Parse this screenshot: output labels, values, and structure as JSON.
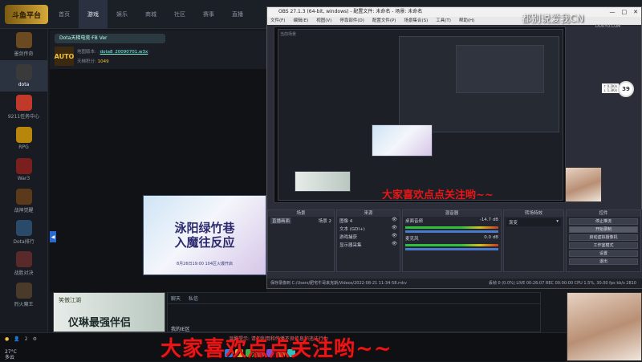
{
  "app": {
    "logo_text": "斗鱼平台",
    "nav": [
      "首页",
      "游戏",
      "娱乐",
      "商城",
      "社区",
      "赛事",
      "直播"
    ]
  },
  "sidebar": {
    "items": [
      {
        "label": "墨剑传奇",
        "color": "#6b4a22"
      },
      {
        "label": "dota",
        "color": "#3a3a3a"
      },
      {
        "label": "9211任务中心",
        "color": "#c0392b"
      },
      {
        "label": "RPG",
        "color": "#b8860b"
      },
      {
        "label": "War3",
        "color": "#7a1e1e"
      },
      {
        "label": "战神觉醒",
        "color": "#5a3a1a"
      },
      {
        "label": "Dota排行",
        "color": "#2a4a6a"
      },
      {
        "label": "战胜对决",
        "color": "#5a2a2a"
      },
      {
        "label": "烈火魔王",
        "color": "#4a3a2a"
      }
    ]
  },
  "room": {
    "title": "Dota天梯电竞·FB Ver",
    "avatar_text": "AUTO",
    "map_label": "地图版本:",
    "map_value": "dota8_20090701.w3x",
    "online_label": "天梯积分:",
    "online_value": "1049"
  },
  "banner": {
    "title_line1": "泳阳绿竹巷",
    "title_line2": "入魔往反应",
    "subtitle": "8月26日19:00 104区火爆开启"
  },
  "poster": {
    "top_text": "笑傲江湖",
    "main_text": "仪琳最强伴侣"
  },
  "chat": {
    "tabs": [
      "聊天",
      "私信"
    ],
    "line": "我的IE区"
  },
  "obs": {
    "title": "OBS 27.1.3 (64-bit, windows) - 配置文件: 未命名 - 场景: 未命名",
    "menu": [
      "文件(F)",
      "编辑(E)",
      "视图(V)",
      "停靠部件(D)",
      "配置文件(P)",
      "场景集合(S)",
      "工具(T)",
      "帮助(H)"
    ],
    "dock_scenes": "场景",
    "dock_sources": "来源",
    "dock_mixer": "混音器",
    "dock_transitions": "转场特效",
    "dock_controls": "控件",
    "scene_items": [
      "直播画面",
      "场景 2"
    ],
    "source_items": [
      "图像 4",
      "文本 (GDI+)",
      "游戏捕获",
      "显示器采集"
    ],
    "mixer_items": [
      {
        "name": "桌面音频",
        "db": "-14.7 dB"
      },
      {
        "name": "麦克风",
        "db": "0.0 dB"
      }
    ],
    "transition_value": "渐变",
    "controls": [
      {
        "label": "停止推流",
        "on": false
      },
      {
        "label": "开始录制",
        "on": true
      },
      {
        "label": "启动虚拟摄像机",
        "on": false
      },
      {
        "label": "工作室模式",
        "on": false
      },
      {
        "label": "设置",
        "on": false
      },
      {
        "label": "退出",
        "on": false
      }
    ],
    "status_left": "保存录像到 C:/Users/肥宅牛哥来克斯/Videos/2022-08-21 11-34-58.mkv",
    "status_right": "丢帧 0 (0.0%)   LIVE 00:26:07   REC 00:00:00   CPU 1.5%, 30.00 fps   kb/s 2810",
    "nested_title": "当前场景"
  },
  "overlay": {
    "follow_text": "大家喜欢点点关注哟~~",
    "small_text": "温馨提示: 请勿利用和传播不良信息和违法行为"
  },
  "watermark": {
    "main": "都别说爱我CN",
    "sub": "DOUYU.COM"
  },
  "net": {
    "percent": "39",
    "up": "↑ 0.2K/s",
    "down": "↓ 1.3K/s"
  },
  "taskbar": {
    "weather_temp": "27°C",
    "weather_desc": "多云",
    "tray_count": "2"
  }
}
